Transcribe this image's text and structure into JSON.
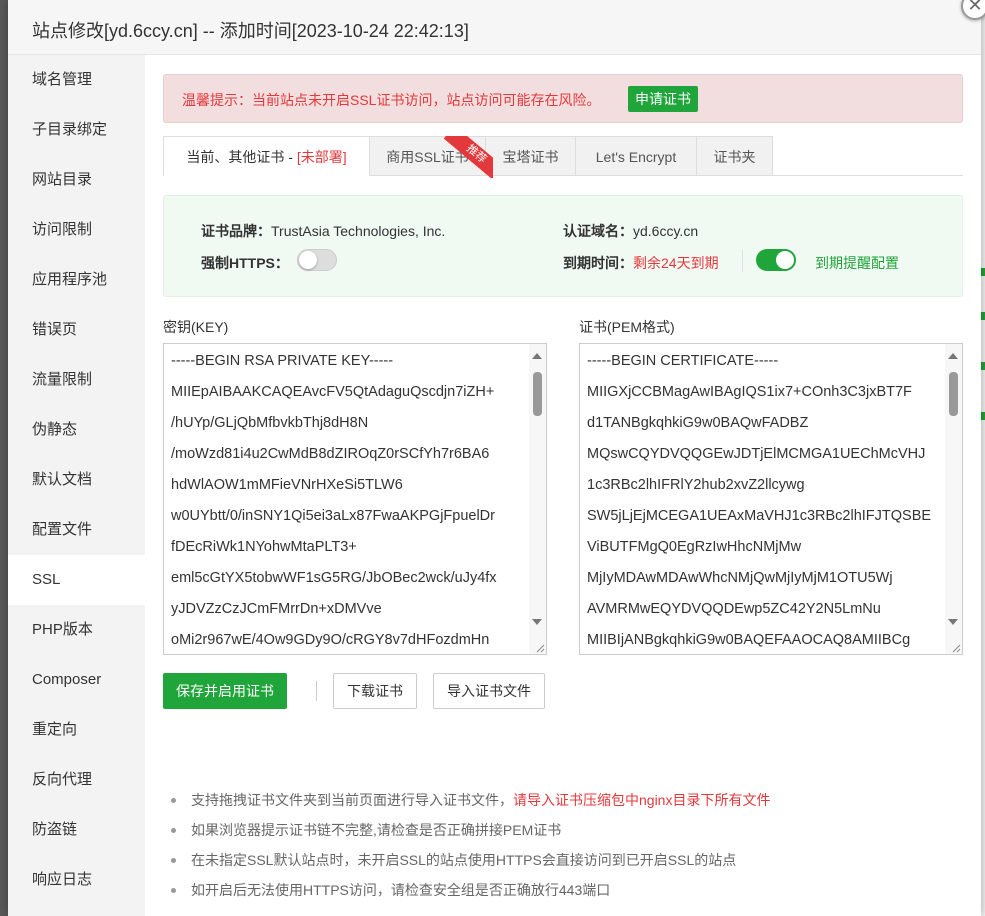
{
  "dialog": {
    "title": "站点修改[yd.6ccy.cn] -- 添加时间[2023-10-24 22:42:13]",
    "close_label": "✕"
  },
  "sidebar": {
    "items": [
      {
        "label": "域名管理"
      },
      {
        "label": "子目录绑定"
      },
      {
        "label": "网站目录"
      },
      {
        "label": "访问限制"
      },
      {
        "label": "应用程序池"
      },
      {
        "label": "错误页"
      },
      {
        "label": "流量限制"
      },
      {
        "label": "伪静态"
      },
      {
        "label": "默认文档"
      },
      {
        "label": "配置文件"
      },
      {
        "label": "SSL",
        "active": true
      },
      {
        "label": "PHP版本"
      },
      {
        "label": "Composer"
      },
      {
        "label": "重定向"
      },
      {
        "label": "反向代理"
      },
      {
        "label": "防盗链"
      },
      {
        "label": "响应日志"
      }
    ]
  },
  "warning": {
    "text": "温馨提示：当前站点未开启SSL证书访问，站点访问可能存在风险。",
    "button": "申请证书"
  },
  "tabs": {
    "current_label": "当前、其他证书 - ",
    "current_status": "[未部署]",
    "commercial": "商用SSL证书",
    "ribbon": "推荐",
    "baota": "宝塔证书",
    "letsencrypt": "Let's Encrypt",
    "folder": "证书夹"
  },
  "cert_info": {
    "brand_label": "证书品牌：",
    "brand_value": "TrustAsia Technologies, Inc.",
    "domain_label": "认证域名：",
    "domain_value": "yd.6ccy.cn",
    "https_label": "强制HTTPS：",
    "https_enabled": false,
    "expiry_label": "到期时间：",
    "expiry_value": "剩余24天到期",
    "reminder_enabled": true,
    "reminder_link": "到期提醒配置"
  },
  "key_panel": {
    "label": "密钥(KEY)",
    "lines": [
      "-----BEGIN RSA PRIVATE KEY-----",
      "MIIEpAIBAAKCAQEAvcFV5QtAdaguQscdjn7iZH+",
      "/hUYp/GLjQbMfbvkbThj8dH8N",
      "/moWzd81i4u2CwMdB8dZIROqZ0rSCfYh7r6BA6",
      "hdWlAOW1mMFieVNrHXeSi5TLW6",
      "w0UYbtt/0/inSNY1Qi5ei3aLx87FwaAKPGjFpuelDr",
      "fDEcRiWk1NYohwMtaPLT3+",
      "eml5cGtYX5tobwWF1sG5RG/JbOBec2wck/uJy4fx",
      "yJDVZzCzJCmFMrrDn+xDMVve",
      "oMi2r967wE/4Ow9GDy9O/cRGY8v7dHFozdmHn"
    ]
  },
  "cert_panel": {
    "label": "证书(PEM格式)",
    "lines": [
      "-----BEGIN CERTIFICATE-----",
      "MIIGXjCCBMagAwIBAgIQS1ix7+COnh3C3jxBT7F",
      "d1TANBgkqhkiG9w0BAQwFADBZ",
      "MQswCQYDVQQGEwJDTjElMCMGA1UEChMcVHJ",
      "1c3RBc2lhIFRlY2hub2xvZ2llcywg",
      "SW5jLjEjMCEGA1UEAxMaVHJ1c3RBc2lhIFJTQSBE",
      "ViBUTFMgQ0EgRzIwHhcNMjMw",
      "MjIyMDAwMDAwWhcNMjQwMjIyMjM1OTU5Wj",
      "AVMRMwEQYDVQQDEwp5ZC42Y2N5LmNu",
      "MIIBIjANBgkqhkiG9w0BAQEFAAOCAQ8AMIIBCg"
    ]
  },
  "actions": {
    "save": "保存并启用证书",
    "download": "下载证书",
    "import": "导入证书文件"
  },
  "tips": {
    "t1_prefix": "支持拖拽证书文件夹到当前页面进行导入证书文件，",
    "t1_red": "请导入证书压缩包中nginx目录下所有文件",
    "t2": "如果浏览器提示证书链不完整,请检查是否正确拼接PEM证书",
    "t3": "在未指定SSL默认站点时，未开启SSL的站点使用HTTPS会直接访问到已开启SSL的站点",
    "t4": "如开启后无法使用HTTPS访问，请检查安全组是否正确放行443端口"
  },
  "colors": {
    "brand_green": "#20a53a",
    "alert_red": "#e4393c",
    "alert_bg": "#f2dede",
    "info_bg": "#f1f9f3"
  }
}
